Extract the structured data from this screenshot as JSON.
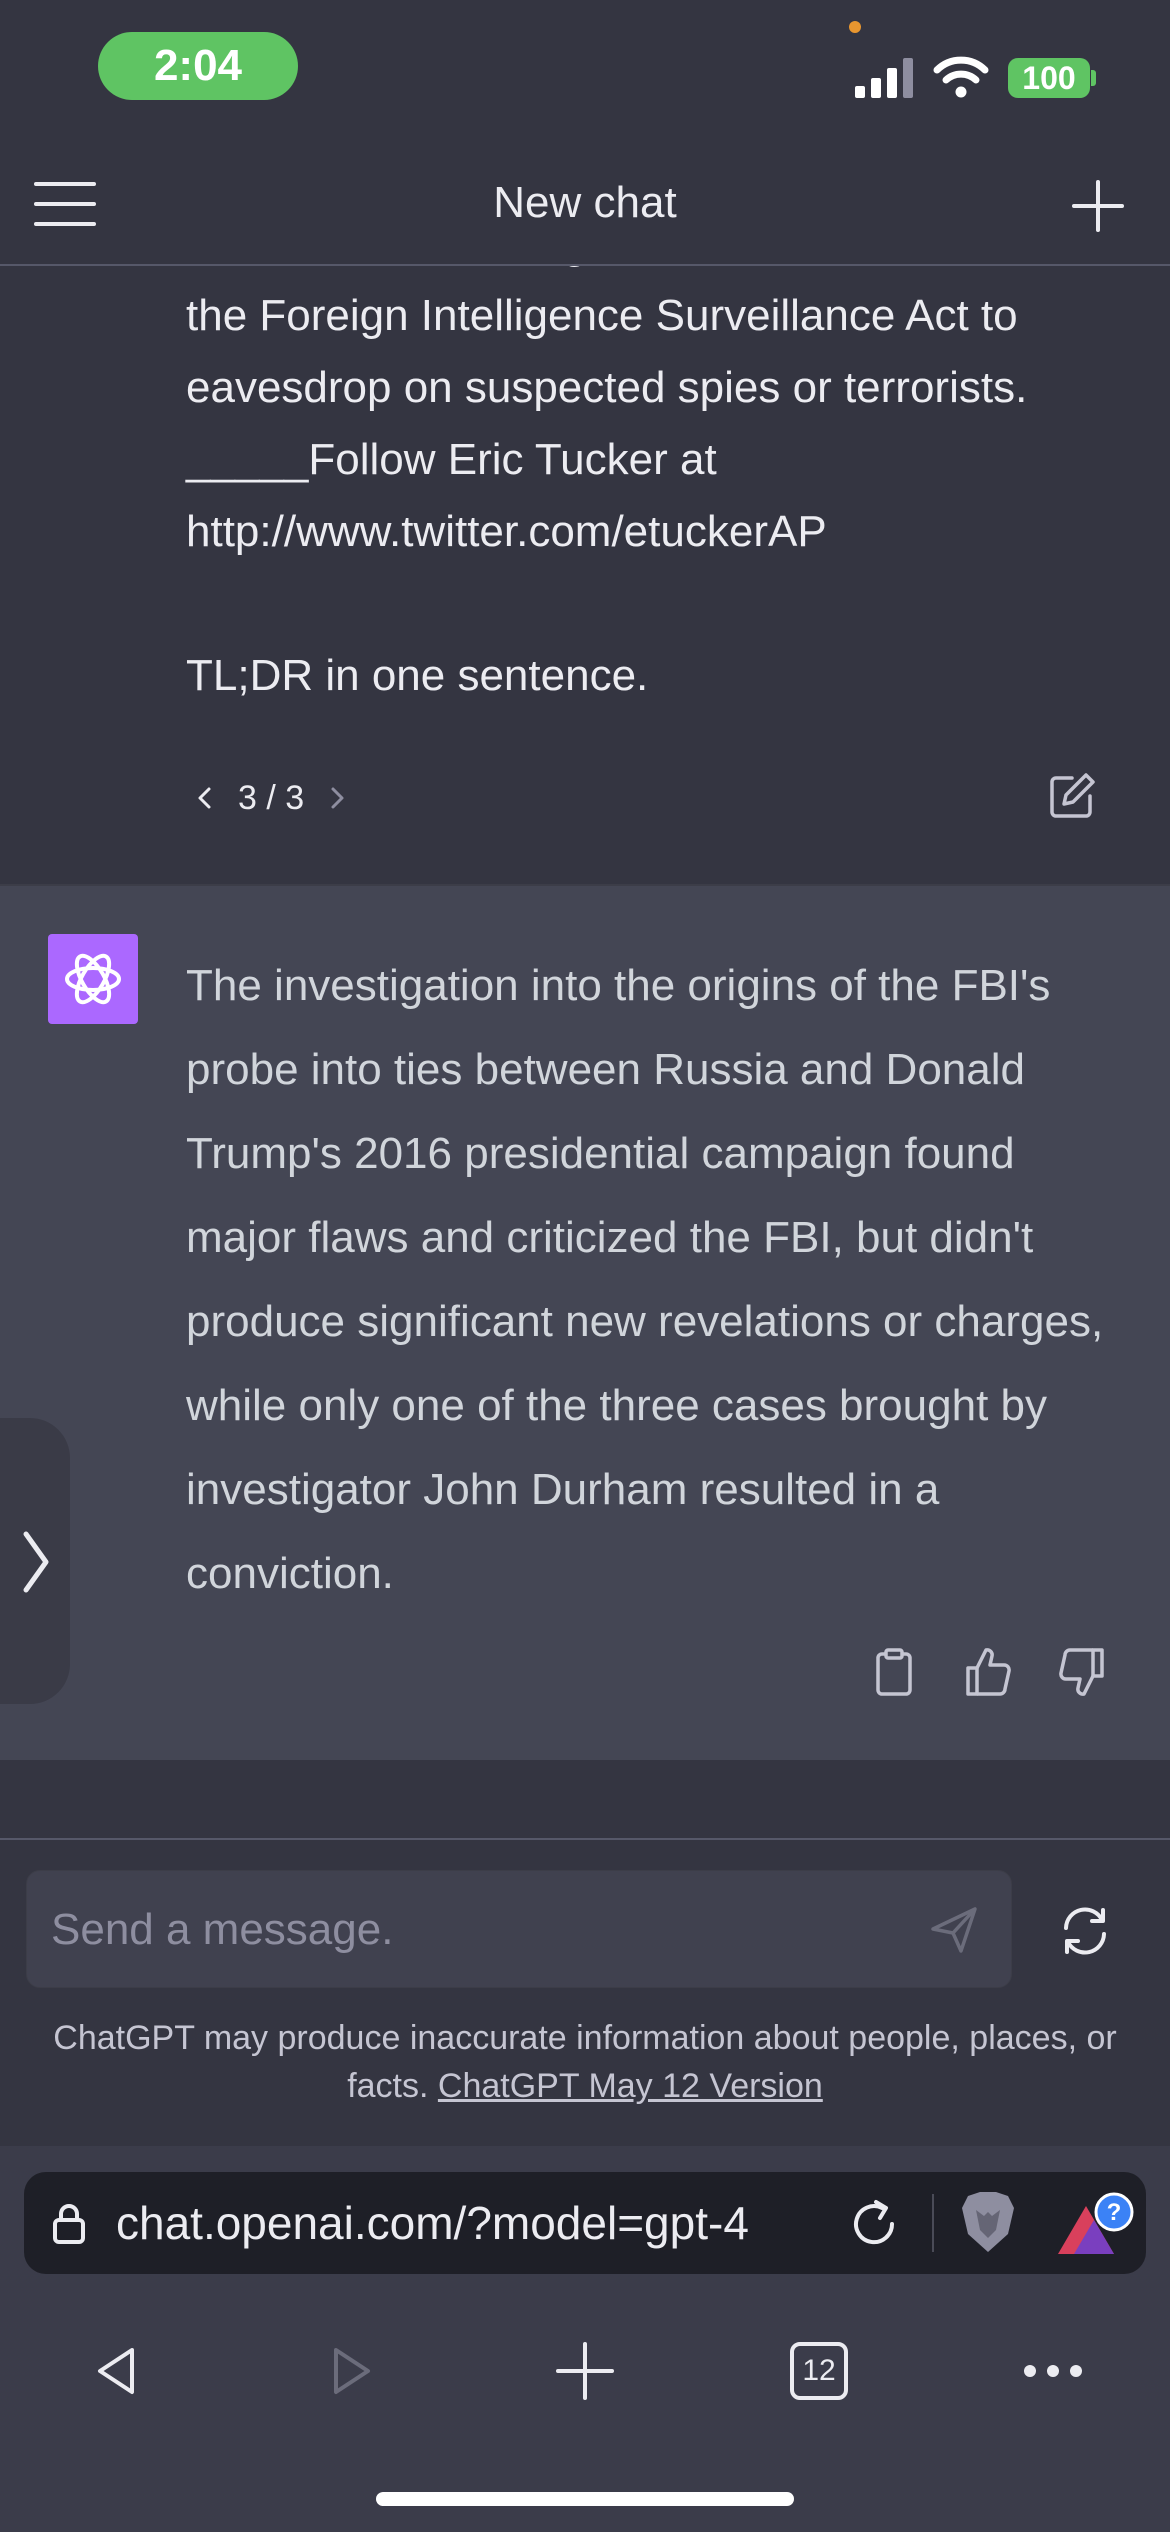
{
  "status_bar": {
    "time": "2:04",
    "battery": "100"
  },
  "header": {
    "title": "New chat"
  },
  "user_message": {
    "text": "authorities, including its use of tools under\nthe Foreign Intelligence Surveillance Act to\neavesdrop on suspected spies or terrorists.\n_____Follow Eric Tucker at\nhttp://www.twitter.com/etuckerAP\n\nTL;DR in one sentence.",
    "pager": "3 / 3"
  },
  "assistant_message": {
    "text": "The investigation into the origins of the FBI's probe into ties between Russia and Donald Trump's 2016 presidential campaign found major flaws and criticized the FBI, but didn't produce significant new revelations or charges, while only one of the three cases brought by investigator John Durham resulted in a conviction."
  },
  "composer": {
    "placeholder": "Send a message."
  },
  "disclaimer": {
    "text": "ChatGPT may produce inaccurate information about people, places, or facts.",
    "link": "ChatGPT May 12 Version"
  },
  "browser": {
    "url": "chat.openai.com/?model=gpt-4",
    "tab_count": "12"
  },
  "colors": {
    "accent": "#ab68ff",
    "status_green": "#5fc463",
    "background": "#343541",
    "assistant_bg": "#444654"
  },
  "icons": [
    "menu-icon",
    "plus-icon",
    "chevron-left-icon",
    "chevron-right-icon",
    "edit-icon",
    "openai-logo-icon",
    "copy-icon",
    "thumbs-up-icon",
    "thumbs-down-icon",
    "send-icon",
    "regenerate-icon",
    "lock-icon",
    "reload-icon",
    "brave-icon",
    "rewards-icon",
    "back-icon",
    "forward-icon",
    "new-tab-icon",
    "tabs-icon",
    "more-icon"
  ]
}
